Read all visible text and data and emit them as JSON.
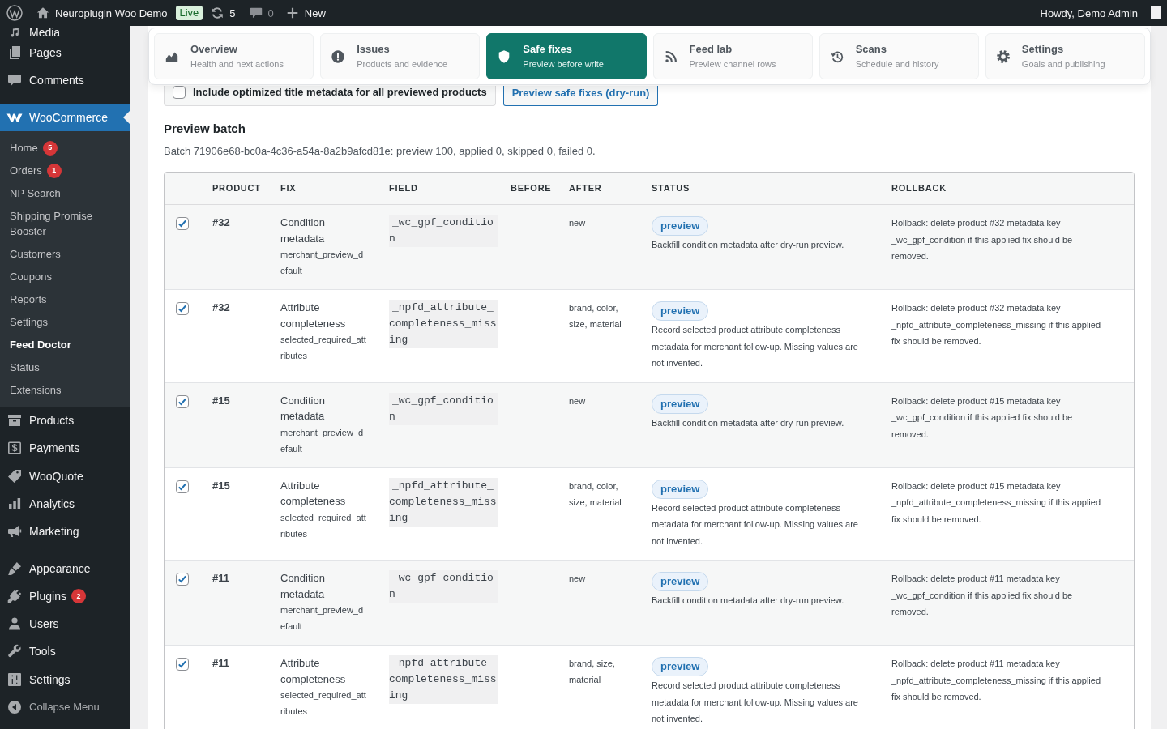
{
  "admin_bar": {
    "site_name": "Neuroplugin Woo Demo",
    "environment_badge": "Live",
    "updates_count": "5",
    "comments_count": "0",
    "new_label": "New",
    "greeting": "Howdy, Demo Admin"
  },
  "sidebar": {
    "menu_groups": [
      {
        "items": [
          {
            "label": "Media",
            "selected": false
          },
          {
            "label": "Pages",
            "selected": false
          },
          {
            "label": "Comments",
            "selected": false
          }
        ]
      },
      {
        "items": [
          {
            "label": "WooCommerce",
            "selected": true,
            "children": [
              {
                "label": "Home",
                "badge": "5",
                "selected": false
              },
              {
                "label": "Orders",
                "badge": "1",
                "selected": false
              },
              {
                "label": "NP Search",
                "selected": false
              },
              {
                "label": "Shipping Promise Booster",
                "selected": false
              },
              {
                "label": "Customers",
                "selected": false
              },
              {
                "label": "Coupons",
                "selected": false
              },
              {
                "label": "Reports",
                "selected": false
              },
              {
                "label": "Settings",
                "selected": false
              },
              {
                "label": "Feed Doctor",
                "selected": true
              },
              {
                "label": "Status",
                "selected": false
              },
              {
                "label": "Extensions",
                "selected": false
              }
            ]
          },
          {
            "label": "Products",
            "selected": false
          },
          {
            "label": "Payments",
            "selected": false
          },
          {
            "label": "WooQuote",
            "selected": false
          },
          {
            "label": "Analytics",
            "selected": false
          },
          {
            "label": "Marketing",
            "selected": false
          }
        ]
      },
      {
        "items": [
          {
            "label": "Appearance",
            "selected": false
          },
          {
            "label": "Plugins",
            "badge": "2",
            "selected": false
          },
          {
            "label": "Users",
            "selected": false
          },
          {
            "label": "Tools",
            "selected": false
          },
          {
            "label": "Settings",
            "selected": false
          }
        ]
      }
    ],
    "collapse_label": "Collapse Menu"
  },
  "tabs": [
    {
      "title": "Overview",
      "subtitle": "Health and next actions",
      "selected": false
    },
    {
      "title": "Issues",
      "subtitle": "Products and evidence",
      "selected": false
    },
    {
      "title": "Safe fixes",
      "subtitle": "Preview before write",
      "selected": true
    },
    {
      "title": "Feed lab",
      "subtitle": "Preview channel rows",
      "selected": false
    },
    {
      "title": "Scans",
      "subtitle": "Schedule and history",
      "selected": false
    },
    {
      "title": "Settings",
      "subtitle": "Goals and publishing",
      "selected": false
    }
  ],
  "dry_run": {
    "include_title": {
      "label": "Include optimized title metadata for all previewed products",
      "checked": false
    },
    "preview_button": "Preview safe fixes (dry-run)"
  },
  "preview_batch": {
    "heading": "Preview batch",
    "summary": "Batch 71906e68-bc0a-4c36-a54a-8a2b9afcd81e: preview 100, applied 0, skipped 0, failed 0.",
    "table": {
      "columns": [
        "PRODUCT",
        "FIX",
        "FIELD",
        "BEFORE",
        "AFTER",
        "STATUS",
        "ROLLBACK"
      ],
      "rows": [
        {
          "selected": true,
          "product": "#32",
          "fix": "Condition metadata",
          "fix_detail": "merchant_preview_default",
          "field": "_wc_gpf_condition",
          "after": "new",
          "status": "preview",
          "status_note": "Backfill condition metadata after dry-run preview.",
          "rollback": "Rollback: delete product #32 metadata key _wc_gpf_condition if this applied fix should be removed."
        },
        {
          "selected": true,
          "product": "#32",
          "fix": "Attribute completeness",
          "fix_detail": "selected_required_attributes",
          "field": "_npfd_attribute_completeness_missing",
          "after": "brand, color, size, material",
          "status": "preview",
          "status_note": "Record selected product attribute completeness metadata for merchant follow-up. Missing values are not invented.",
          "rollback": "Rollback: delete product #32 metadata key _npfd_attribute_completeness_missing if this applied fix should be removed."
        },
        {
          "selected": true,
          "product": "#15",
          "fix": "Condition metadata",
          "fix_detail": "merchant_preview_default",
          "field": "_wc_gpf_condition",
          "after": "new",
          "status": "preview",
          "status_note": "Backfill condition metadata after dry-run preview.",
          "rollback": "Rollback: delete product #15 metadata key _wc_gpf_condition if this applied fix should be removed."
        },
        {
          "selected": true,
          "product": "#15",
          "fix": "Attribute completeness",
          "fix_detail": "selected_required_attributes",
          "field": "_npfd_attribute_completeness_missing",
          "after": "brand, color, size, material",
          "status": "preview",
          "status_note": "Record selected product attribute completeness metadata for merchant follow-up. Missing values are not invented.",
          "rollback": "Rollback: delete product #15 metadata key _npfd_attribute_completeness_missing if this applied fix should be removed."
        },
        {
          "selected": true,
          "product": "#11",
          "fix": "Condition metadata",
          "fix_detail": "merchant_preview_default",
          "field": "_wc_gpf_condition",
          "after": "new",
          "status": "preview",
          "status_note": "Backfill condition metadata after dry-run preview.",
          "rollback": "Rollback: delete product #11 metadata key _wc_gpf_condition if this applied fix should be removed."
        },
        {
          "selected": true,
          "product": "#11",
          "fix": "Attribute completeness",
          "fix_detail": "selected_required_attributes",
          "field": "_npfd_attribute_completeness_missing",
          "after": "brand, size, material",
          "status": "preview",
          "status_note": "Record selected product attribute completeness metadata for merchant follow-up. Missing values are not invented.",
          "rollback": "Rollback: delete product #11 metadata key _npfd_attribute_completeness_missing if this applied fix should be removed."
        }
      ]
    }
  }
}
